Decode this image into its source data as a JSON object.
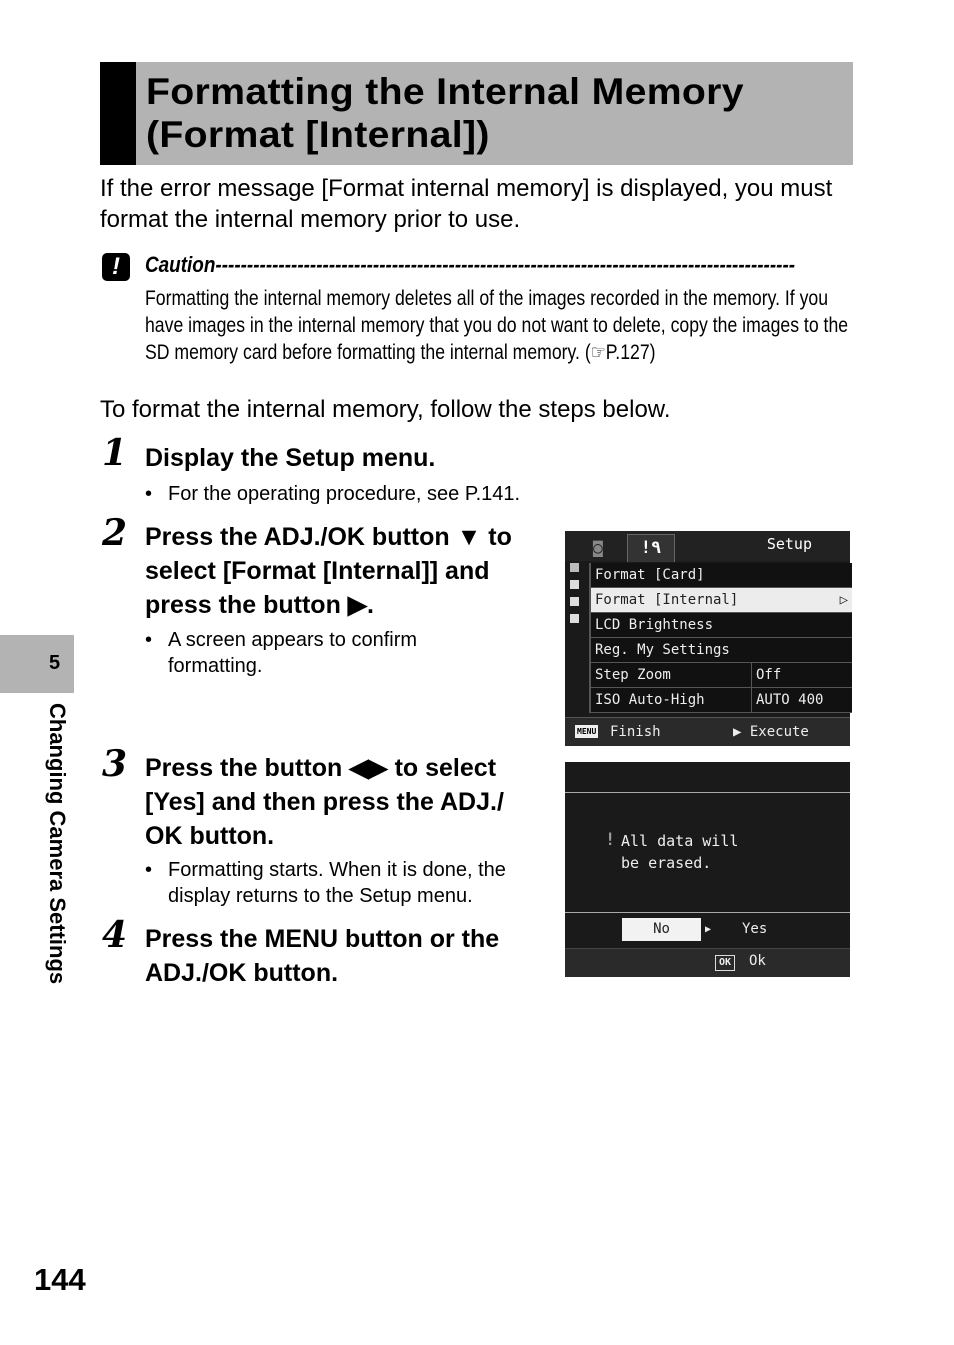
{
  "header": {
    "title_line1": "Formatting the Internal Memory",
    "title_line2": "(Format [Internal])"
  },
  "intro": "If the error message [Format internal memory] is displayed, you must format the internal memory prior to use.",
  "caution": {
    "icon": "caution-exclamation-icon",
    "heading": "Caution--------------------------------------------------------------------------------------------",
    "body": "Formatting the internal memory deletes all of the images recorded in the memory. If you have images in the internal memory that you do not want to delete, copy the images to the SD memory card before formatting the internal memory. (",
    "ref_icon": "pointing-hand-icon",
    "ref_page": "P.127)"
  },
  "follow_text": "To format the internal memory, follow the steps below.",
  "steps": [
    {
      "number": "1",
      "title": "Display the Setup menu.",
      "bullets": [
        "For the operating procedure, see P.141."
      ]
    },
    {
      "number": "2",
      "title_lines": [
        "Press the ADJ./OK button ▼ to",
        "select [Format [Internal]] and",
        "press the button ▶."
      ],
      "bullets": [
        "A screen appears to confirm formatting."
      ]
    },
    {
      "number": "3",
      "title_lines": [
        "Press the button ◀▶ to select",
        "[Yes] and then press the ADJ./",
        "OK button."
      ],
      "bullets": [
        "Formatting starts. When it is done, the display returns to the Setup menu."
      ]
    },
    {
      "number": "4",
      "title_lines": [
        "Press the MENU button or the",
        "ADJ./OK button."
      ]
    }
  ],
  "setup_screen": {
    "tab_camera_icon": "camera-icon",
    "tab_setup_icon": "wrench-icon",
    "title": "Setup",
    "items": [
      {
        "label": "Format [Card]",
        "value": ""
      },
      {
        "label": "Format [Internal]",
        "value": "",
        "selected": true,
        "arrow": "▷"
      },
      {
        "label": "LCD Brightness",
        "value": ""
      },
      {
        "label": "Reg. My Settings",
        "value": ""
      },
      {
        "label": "Step Zoom",
        "value": "Off"
      },
      {
        "label": "ISO Auto-High",
        "value": "AUTO 400"
      }
    ],
    "footer_key": "MENU",
    "footer_finish": "Finish",
    "footer_execute": "▶ Execute"
  },
  "confirm_screen": {
    "warning_icon": "!",
    "message_line1": "All data will",
    "message_line2": "be erased.",
    "option_no": "No",
    "option_arrow": "▶",
    "option_yes": "Yes",
    "ok_key": "OK",
    "ok_label": "Ok"
  },
  "chapter": {
    "number": "5",
    "title": "Changing Camera Settings"
  },
  "page_number": "144"
}
